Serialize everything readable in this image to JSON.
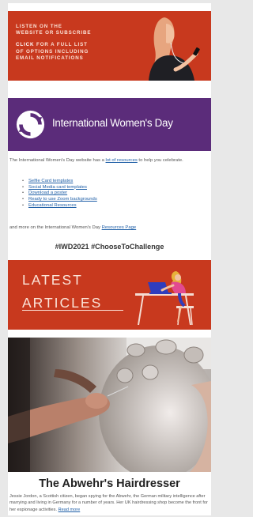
{
  "listen_banner": {
    "line1": "LISTEN ON THE",
    "line2": "WEBSITE OR SUBSCRIBE",
    "click_word": "CLICK",
    "line3": " FOR A FULL LIST",
    "line4": "OF OPTIONS INCLUDING",
    "line5": "EMAIL NOTIFICATIONS"
  },
  "iwd": {
    "title": "International Women's Day",
    "intro_prefix": "The International Women's Day website has a ",
    "intro_link": "lot of resources",
    "intro_suffix": " to help you celebrate.",
    "resources": [
      "Selfie Card templates",
      "Social Media card templates",
      "Download a poster",
      "Ready to use Zoom backgrounds",
      "Educational Resources"
    ],
    "more_prefix": "and more on the International Women's Day ",
    "more_link": "Resources Page",
    "hashtags": "#IWD2021  #ChooseToChallenge"
  },
  "latest": {
    "line1": "LATEST",
    "line2": "ARTICLES"
  },
  "article": {
    "title": "The Abwehr's Hairdresser",
    "body": "Jessie Jordon, a Scottish citizen, began spying for the Abwehr, the German military intelligence after marrying and living in Germany for a number of years.  Her UK hairdressing shop become the front for her espionage activities. ",
    "read_more": "Read more"
  },
  "colors": {
    "banner_red": "#c8391e",
    "iwd_purple": "#5b2c7a",
    "link_blue": "#1f5fa7"
  }
}
